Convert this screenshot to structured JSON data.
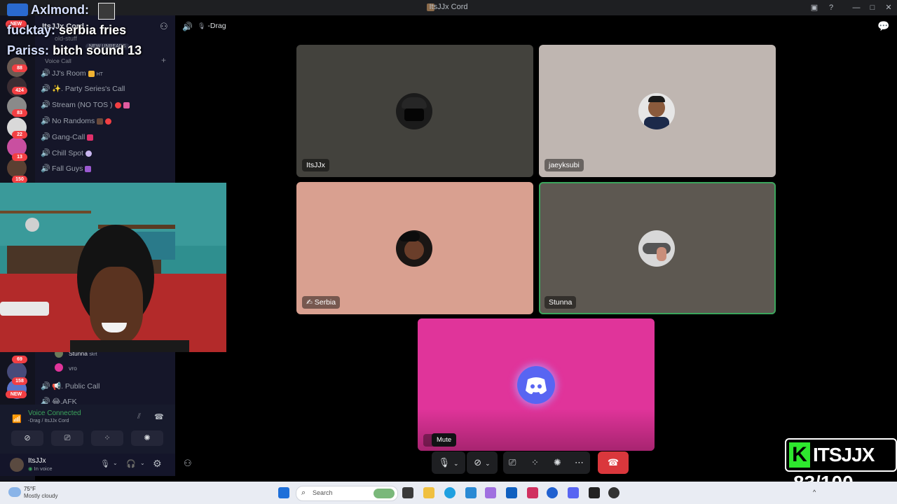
{
  "window": {
    "title": "ItsJJx Cord"
  },
  "stage_header": {
    "channel": "-Drag"
  },
  "server_rail": {
    "badges": [
      "NEW",
      "88",
      "424",
      "83",
      "22",
      "13",
      "150",
      "69",
      "158",
      "NEW"
    ]
  },
  "server_header": {
    "name": "ItsJJx Cord",
    "old_stuff": "old-stuff",
    "new_unreads": "NEW UNREADS",
    "category": "Voice Call"
  },
  "channels": [
    {
      "name": "JJ's Room",
      "suffix": "HT"
    },
    {
      "name": "✨. Party Series's Call",
      "suffix": ""
    },
    {
      "name": "Stream (NO TOS )",
      "suffix": ""
    },
    {
      "name": "No Randoms",
      "suffix": ""
    },
    {
      "name": "Gang-Call",
      "suffix": ""
    },
    {
      "name": "Chill Spot",
      "suffix": ""
    },
    {
      "name": "Fall Guys",
      "suffix": ""
    }
  ],
  "voice_members": [
    {
      "name": "Stunna",
      "tag": "skrt"
    },
    {
      "name": "vro",
      "tag": ""
    }
  ],
  "more_channels": [
    {
      "name": "📢. Public Call"
    },
    {
      "name": "😂.AFK"
    }
  ],
  "voice_status": {
    "title": "Voice Connected",
    "subtitle": "-Drag / ItsJJx Cord"
  },
  "user": {
    "name": "ItsJJx",
    "status": "In voice"
  },
  "participants": [
    {
      "name": "ItsJJx",
      "bg": "#43423d"
    },
    {
      "name": "jaeyksubi",
      "bg": "#bfb6b1"
    },
    {
      "name": "Serbia",
      "bg": "#d9a090",
      "muted": true
    },
    {
      "name": "Stunna",
      "bg": "#5d5851",
      "speaking": true
    }
  ],
  "stream_tile": {
    "bg": "#e0349a",
    "tooltip": "Mute"
  },
  "chat_overlay": [
    {
      "nick": "Axlmond:",
      "msg": ""
    },
    {
      "nick": "fucktay:",
      "msg": "serbia fries"
    },
    {
      "nick": "Pariss:",
      "msg": "bitch sound 13"
    }
  ],
  "brand_overlay": {
    "text": "ITSJJX",
    "counter": "83/100"
  },
  "taskbar": {
    "weather_temp": "75°F",
    "weather_desc": "Mostly cloudy",
    "search_placeholder": "Search"
  },
  "colors": {
    "discord_blurple": "#5865f2",
    "hangup_red": "#da373c",
    "speaking_green": "#3ba55c",
    "brand_green": "#2ee82e"
  }
}
